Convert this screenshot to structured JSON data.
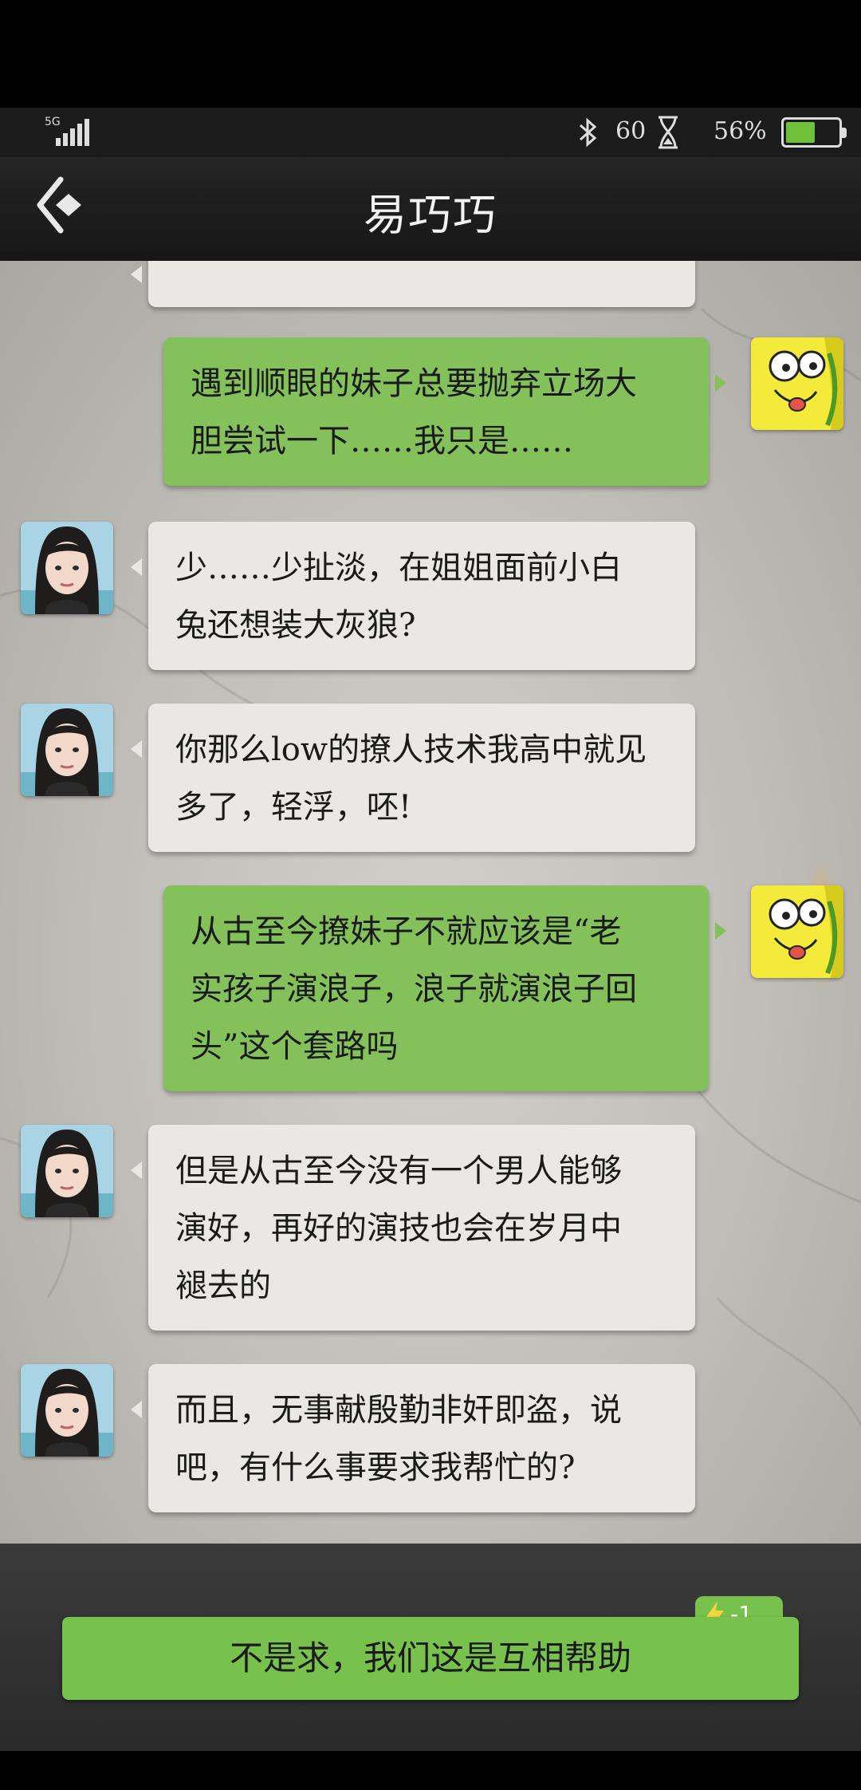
{
  "status_bar": {
    "network": "5G",
    "bluetooth_icon": "bluetooth-icon",
    "value": "60",
    "hourglass_icon": "hourglass-icon",
    "battery_percent": "56%",
    "battery_level": 0.56
  },
  "header": {
    "back_icon": "back-arrow-icon",
    "title": "易巧巧"
  },
  "messages": [
    {
      "side": "in",
      "text": "",
      "partial": true
    },
    {
      "side": "out",
      "lines": [
        "遇到顺眼的妹子总要抛弃立场大",
        "胆尝试一下……我只是……"
      ]
    },
    {
      "side": "in",
      "lines": [
        "少……少扯淡，在姐姐面前小白",
        "兔还想装大灰狼?"
      ]
    },
    {
      "side": "in",
      "lines": [
        "你那么low的撩人技术我高中就见",
        "多了，轻浮，呸!"
      ]
    },
    {
      "side": "out",
      "lines": [
        "从古至今撩妹子不就应该是“老",
        "实孩子演浪子，浪子就演浪子回",
        "头”这个套路吗"
      ]
    },
    {
      "side": "in",
      "lines": [
        "但是从古至今没有一个男人能够",
        "演好，再好的演技也会在岁月中",
        "褪去的"
      ]
    },
    {
      "side": "in",
      "lines": [
        "而且，无事献殷勤非奸即盗，说",
        "吧，有什么事要求我帮忙的?"
      ]
    }
  ],
  "reply": {
    "label": "不是求，我们这是互相帮助",
    "cost_icon": "lightning-icon",
    "cost": "-1"
  },
  "colors": {
    "outgoing_bubble": "#84c15a",
    "incoming_bubble": "#e9e8e4",
    "reply_button": "#77c14c"
  }
}
